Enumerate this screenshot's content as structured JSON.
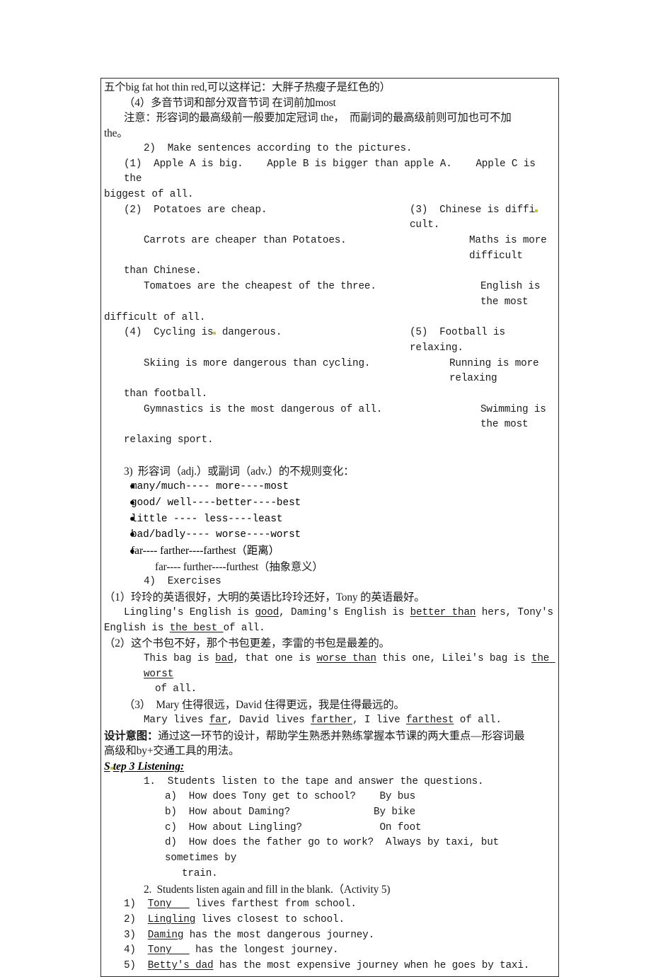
{
  "document": {
    "type": "lesson-plan-worksheet",
    "border_color": "#2b2b2b",
    "highlight_color": "#d8d44a"
  },
  "body": {
    "line_mnemonic": "五个big fat hot thin red,可以这样记：大胖子热瘦子是红色的）",
    "rule4": "（4）多音节词和部分双音节词 在词前加most",
    "note_line1": "注意：形容词的最高级前一般要加定冠词 the，  而副词的最高级前则可加也可不加",
    "note_line2": "the。",
    "make_sentences": "2)  Make sentences according to the pictures.",
    "ex1_line1": "(1)  Apple A is big.    Apple B is bigger than apple A.    Apple C is the",
    "ex1_line2": "biggest of all.",
    "ex2_head": "(2)  Potatoes are cheap.",
    "ex3_head_a": "(3)  Chinese is diffi",
    "ex3_head_b": "cult.",
    "ex2_l2": "Carrots are cheaper than Potatoes.",
    "ex3_l2": "Maths is more difficult",
    "ex2_l3": "than Chinese.",
    "ex2_l4": "Tomatoes are the cheapest of the three.",
    "ex3_l3": "English is the most",
    "ex2_l5": "difficult of all.",
    "ex4_head_a": "(4)  Cycling is",
    "ex4_head_b": " dangerous.",
    "ex5_head": "(5)  Football is relaxing.",
    "ex4_l2": "Skiing is more dangerous than cycling.",
    "ex5_l2": "Running is more relaxing",
    "ex4_l3": "than football.",
    "ex4_l4": "Gymnastics is the most dangerous of all.",
    "ex5_l3": "Swimming is the most",
    "ex4_l5": "relaxing sport.",
    "irregular_head": "3)  形容词（adj.）或副词（adv.）的不规则变化：",
    "bullets": [
      "many/much---- more----most",
      "good/ well----better----best",
      "little ---- less----least",
      "bad/badly---- worse----worst",
      "far---- farther----farthest（距离）"
    ],
    "bullet_sub": "far---- further----furthest（抽象意义）",
    "exercises_head": "4)  Exercises",
    "q1_cn": "（1）玲玲的英语很好，大明的英语比玲玲还好，Tony 的英语最好。",
    "q1_en_p1": "Lingling's English is ",
    "q1_en_u1": "good",
    "q1_en_p2": ", Daming's English is ",
    "q1_en_u2": "better than",
    "q1_en_p3": " hers, Tony's",
    "q1_en_l2_p1": "English is ",
    "q1_en_l2_u1": "the best ",
    "q1_en_l2_p2": "of all.",
    "q2_cn": "（2）这个书包不好，那个书包更差，李雷的书包是最差的。",
    "q2_en_p1": "This bag is ",
    "q2_en_u1": "bad",
    "q2_en_p2": ", that one is ",
    "q2_en_u2": "worse than",
    "q2_en_p3": " this one, Lilei's bag is ",
    "q2_en_u3": "the worst",
    "q2_en_l2": "of all.",
    "q3_cn": "（3）  Mary 住得很远，David 住得更远，我是住得最远的。",
    "q3_en_p1": "Mary lives ",
    "q3_en_u1": "far",
    "q3_en_p2": ", David lives ",
    "q3_en_u2": "farther",
    "q3_en_p3": ", I live ",
    "q3_en_u3": "farthest",
    "q3_en_p4": " of all.",
    "design_label": "设计意图：",
    "design_text_l1": "通过这一环节的设计，帮助学生熟悉并熟练掌握本节课的两大重点—形容词最",
    "design_text_l2": "高级和by+交通工具的用法。",
    "step3_title_first": "S",
    "step3_title_rest": "tep 3 Listening:",
    "listen_1": "1.  Students listen to the tape and answer the questions.",
    "listen_a": "a)  How does Tony get to school?    By bus",
    "listen_b": "b)  How about Daming?              By bike",
    "listen_c": "c)  How about Lingling?             On foot",
    "listen_d": "d)  How does the father go to work?  Always by taxi, but sometimes by",
    "listen_d2": "train.",
    "listen_2": "2.  Students listen again and fill in the blank.（Activity 5)",
    "fill": [
      {
        "num": "1)  ",
        "blank": "Tony   ",
        "rest": " lives farthest from school."
      },
      {
        "num": "2)  ",
        "blank": "Lingling",
        "rest": " lives closest to school."
      },
      {
        "num": "3)  ",
        "blank": "Daming",
        "rest": " has the most dangerous journey."
      },
      {
        "num": "4)  ",
        "blank": "Tony   ",
        "rest": " has the longest journey."
      },
      {
        "num": "5)  ",
        "blank": "Betty's dad",
        "rest": " has the most expensive journey when he goes by taxi."
      }
    ]
  }
}
